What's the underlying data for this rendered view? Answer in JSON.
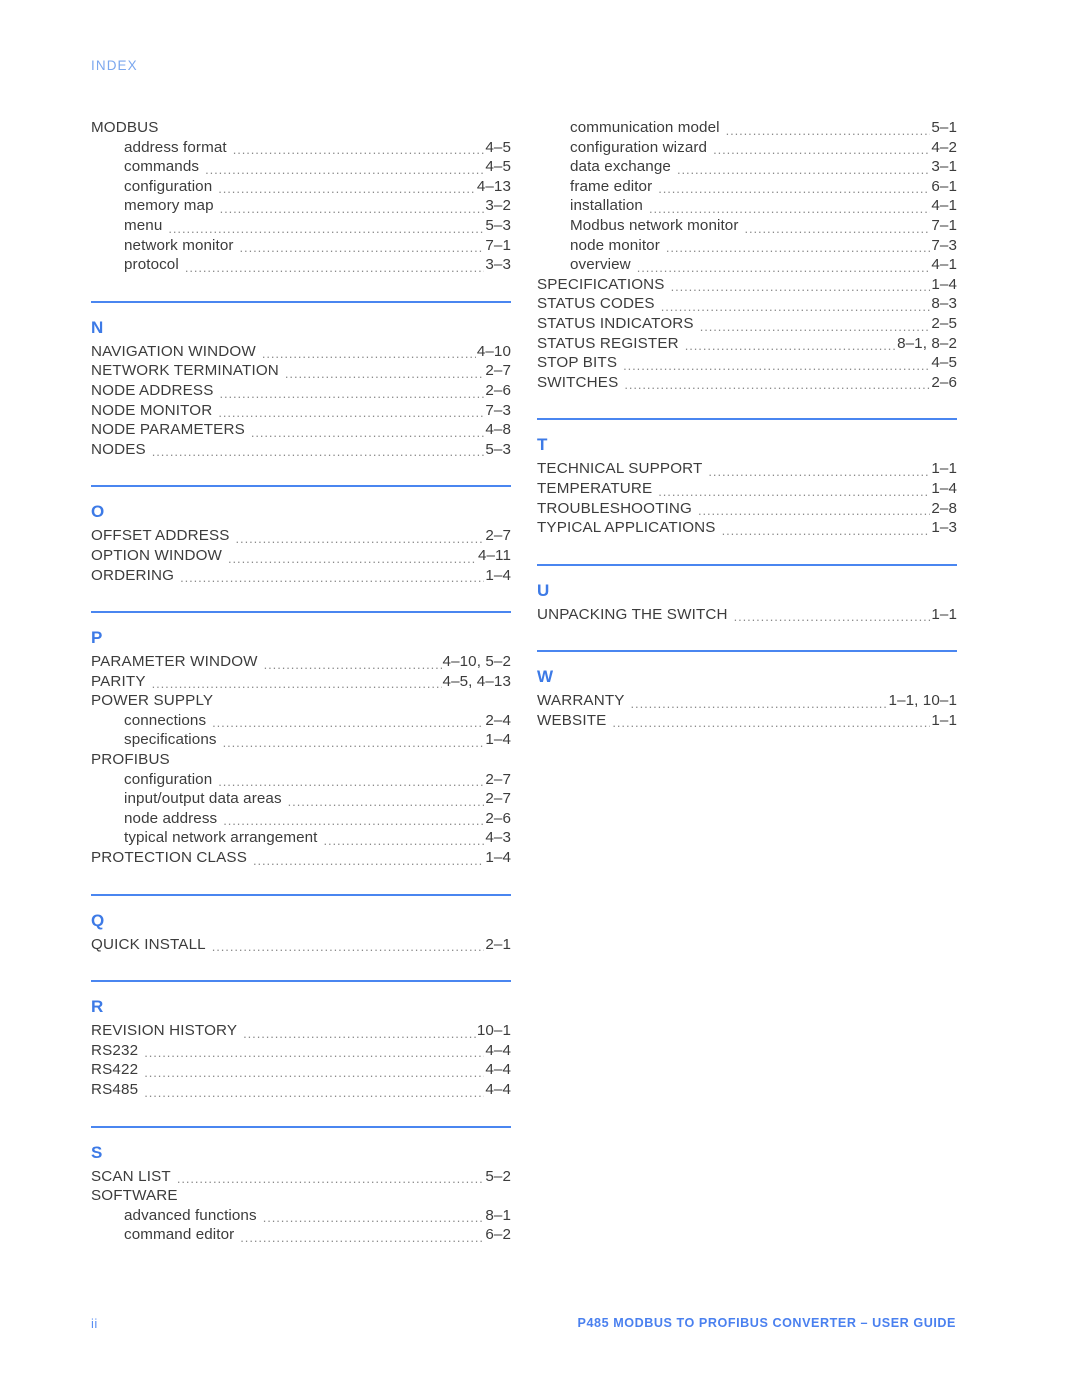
{
  "header": {
    "label": "INDEX"
  },
  "colors": {
    "accent_blue": "#4a86f0",
    "letter_blue": "#3d7ae6",
    "header_blue": "#7ba7ee",
    "footer_blue": "#4a80ef",
    "text_gray": "#3c3c3c",
    "leader_gray": "#8a8a8a"
  },
  "footer": {
    "page_number": "ii",
    "title": "P485 MODBUS TO PROFIBUS CONVERTER – USER GUIDE"
  },
  "columns": {
    "left": [
      {
        "letter": "",
        "show_rule": false,
        "entries": [
          {
            "label": "MODBUS",
            "page": "",
            "level": "main",
            "group": true
          },
          {
            "label": "address format",
            "page": "4–5",
            "level": "sub"
          },
          {
            "label": "commands",
            "page": "4–5",
            "level": "sub"
          },
          {
            "label": "configuration",
            "page": "4–13",
            "level": "sub"
          },
          {
            "label": "memory map",
            "page": "3–2",
            "level": "sub"
          },
          {
            "label": "menu",
            "page": "5–3",
            "level": "sub"
          },
          {
            "label": "network monitor",
            "page": "7–1",
            "level": "sub"
          },
          {
            "label": "protocol",
            "page": "3–3",
            "level": "sub"
          }
        ]
      },
      {
        "letter": "N",
        "show_rule": true,
        "entries": [
          {
            "label": "NAVIGATION WINDOW",
            "page": "4–10",
            "level": "main"
          },
          {
            "label": "NETWORK TERMINATION",
            "page": "2–7",
            "level": "main"
          },
          {
            "label": "NODE ADDRESS",
            "page": "2–6",
            "level": "main"
          },
          {
            "label": "NODE MONITOR",
            "page": "7–3",
            "level": "main"
          },
          {
            "label": "NODE PARAMETERS",
            "page": "4–8",
            "level": "main"
          },
          {
            "label": "NODES",
            "page": "5–3",
            "level": "main"
          }
        ]
      },
      {
        "letter": "O",
        "show_rule": true,
        "entries": [
          {
            "label": "OFFSET ADDRESS",
            "page": "2–7",
            "level": "main"
          },
          {
            "label": "OPTION WINDOW",
            "page": "4–11",
            "level": "main"
          },
          {
            "label": "ORDERING",
            "page": "1–4",
            "level": "main"
          }
        ]
      },
      {
        "letter": "P",
        "show_rule": true,
        "entries": [
          {
            "label": "PARAMETER WINDOW",
            "page": "4–10, 5–2",
            "level": "main"
          },
          {
            "label": "PARITY",
            "page": "4–5, 4–13",
            "level": "main"
          },
          {
            "label": "POWER SUPPLY",
            "page": "",
            "level": "main",
            "group": true
          },
          {
            "label": "connections",
            "page": "2–4",
            "level": "sub"
          },
          {
            "label": "specifications",
            "page": "1–4",
            "level": "sub"
          },
          {
            "label": "PROFIBUS",
            "page": "",
            "level": "main",
            "group": true
          },
          {
            "label": "configuration",
            "page": "2–7",
            "level": "sub"
          },
          {
            "label": "input/output data areas",
            "page": "2–7",
            "level": "sub"
          },
          {
            "label": "node address",
            "page": "2–6",
            "level": "sub"
          },
          {
            "label": "typical network arrangement",
            "page": "4–3",
            "level": "sub"
          },
          {
            "label": "PROTECTION CLASS",
            "page": "1–4",
            "level": "main"
          }
        ]
      },
      {
        "letter": "Q",
        "show_rule": true,
        "entries": [
          {
            "label": "QUICK INSTALL",
            "page": "2–1",
            "level": "main"
          }
        ]
      },
      {
        "letter": "R",
        "show_rule": true,
        "entries": [
          {
            "label": "REVISION HISTORY",
            "page": "10–1",
            "level": "main"
          },
          {
            "label": "RS232",
            "page": "4–4",
            "level": "main"
          },
          {
            "label": "RS422",
            "page": "4–4",
            "level": "main"
          },
          {
            "label": "RS485",
            "page": "4–4",
            "level": "main"
          }
        ]
      },
      {
        "letter": "S",
        "show_rule": true,
        "entries": [
          {
            "label": "SCAN LIST",
            "page": "5–2",
            "level": "main"
          },
          {
            "label": "SOFTWARE",
            "page": "",
            "level": "main",
            "group": true
          },
          {
            "label": "advanced functions",
            "page": "8–1",
            "level": "sub"
          },
          {
            "label": "command editor",
            "page": "6–2",
            "level": "sub"
          }
        ]
      }
    ],
    "right": [
      {
        "letter": "",
        "show_rule": false,
        "entries": [
          {
            "label": "communication model",
            "page": "5–1",
            "level": "sub"
          },
          {
            "label": "configuration wizard",
            "page": "4–2",
            "level": "sub"
          },
          {
            "label": "data exchange",
            "page": "3–1",
            "level": "sub"
          },
          {
            "label": "frame editor",
            "page": "6–1",
            "level": "sub"
          },
          {
            "label": "installation",
            "page": "4–1",
            "level": "sub"
          },
          {
            "label": "Modbus network monitor",
            "page": "7–1",
            "level": "sub"
          },
          {
            "label": "node monitor",
            "page": "7–3",
            "level": "sub"
          },
          {
            "label": "overview",
            "page": "4–1",
            "level": "sub"
          },
          {
            "label": "SPECIFICATIONS",
            "page": "1–4",
            "level": "main"
          },
          {
            "label": "STATUS CODES",
            "page": "8–3",
            "level": "main"
          },
          {
            "label": "STATUS INDICATORS",
            "page": "2–5",
            "level": "main"
          },
          {
            "label": "STATUS REGISTER",
            "page": "8–1, 8–2",
            "level": "main"
          },
          {
            "label": "STOP BITS",
            "page": "4–5",
            "level": "main"
          },
          {
            "label": "SWITCHES",
            "page": "2–6",
            "level": "main"
          }
        ]
      },
      {
        "letter": "T",
        "show_rule": true,
        "entries": [
          {
            "label": "TECHNICAL SUPPORT",
            "page": "1–1",
            "level": "main"
          },
          {
            "label": "TEMPERATURE",
            "page": "1–4",
            "level": "main"
          },
          {
            "label": "TROUBLESHOOTING",
            "page": "2–8",
            "level": "main"
          },
          {
            "label": "TYPICAL APPLICATIONS",
            "page": "1–3",
            "level": "main"
          }
        ]
      },
      {
        "letter": "U",
        "show_rule": true,
        "entries": [
          {
            "label": "UNPACKING THE SWITCH",
            "page": "1–1",
            "level": "main"
          }
        ]
      },
      {
        "letter": "W",
        "show_rule": true,
        "entries": [
          {
            "label": "WARRANTY",
            "page": "1–1, 10–1",
            "level": "main"
          },
          {
            "label": "WEBSITE",
            "page": "1–1",
            "level": "main"
          }
        ]
      }
    ]
  }
}
